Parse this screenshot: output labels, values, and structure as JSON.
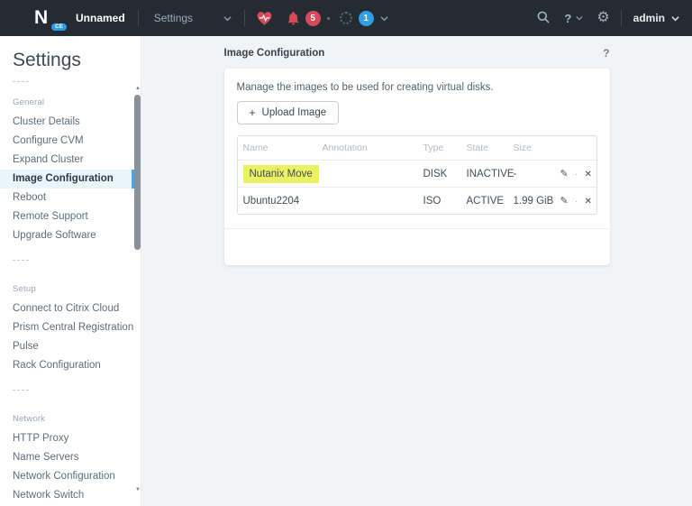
{
  "topbar": {
    "logo_letter": "N",
    "logo_badge": "CE",
    "cluster_name": "Unnamed",
    "menu_label": "Settings",
    "alerts_badge": "5",
    "tasks_badge": "1",
    "help_label": "?",
    "user": "admin"
  },
  "icons": {
    "plus": "+",
    "pencil": "✎",
    "close": "✕",
    "dot": "·",
    "gear": "⚙",
    "arrow_up": "▲",
    "arrow_down": "▼"
  },
  "colors": {
    "topbar_bg": "#252b33",
    "alert_red": "#d8495a",
    "task_blue": "#2f9ee2",
    "selected_blue": "#42a6ea",
    "highlight_yellow": "#ebf161"
  },
  "sidebar": {
    "title": "Settings",
    "sections": [
      {
        "label": "General",
        "items": [
          {
            "label": "Cluster Details"
          },
          {
            "label": "Configure CVM"
          },
          {
            "label": "Expand Cluster"
          },
          {
            "label": "Image Configuration",
            "selected": true
          },
          {
            "label": "Reboot"
          },
          {
            "label": "Remote Support"
          },
          {
            "label": "Upgrade Software"
          }
        ]
      },
      {
        "label": "Setup",
        "items": [
          {
            "label": "Connect to Citrix Cloud"
          },
          {
            "label": "Prism Central Registration"
          },
          {
            "label": "Pulse"
          },
          {
            "label": "Rack Configuration"
          }
        ]
      },
      {
        "label": "Network",
        "items": [
          {
            "label": "HTTP Proxy"
          },
          {
            "label": "Name Servers"
          },
          {
            "label": "Network Configuration"
          },
          {
            "label": "Network Switch"
          }
        ]
      }
    ]
  },
  "main": {
    "title": "Image Configuration",
    "help": "?",
    "description": "Manage the images to be used for creating virtual disks.",
    "upload_button": "Upload Image",
    "table": {
      "headers": {
        "name": "Name",
        "annotation": "Annotation",
        "type": "Type",
        "state": "State",
        "size": "Size"
      },
      "rows": [
        {
          "name": "Nutanix Move",
          "annotation": "",
          "type": "DISK",
          "state": "INACTIVE",
          "size": "-"
        },
        {
          "name": "Ubuntu2204",
          "annotation": "",
          "type": "ISO",
          "state": "ACTIVE",
          "size": "1.99 GiB"
        }
      ]
    }
  }
}
